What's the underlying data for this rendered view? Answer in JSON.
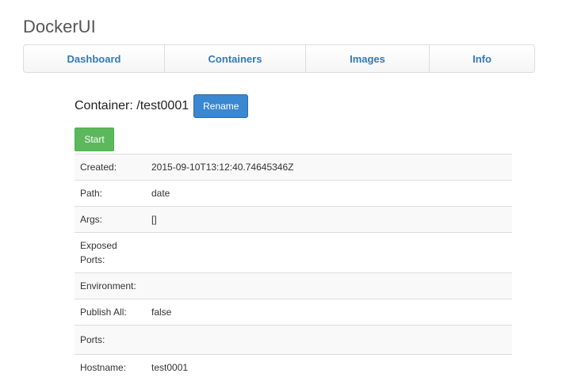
{
  "app": {
    "title": "DockerUI"
  },
  "nav": {
    "items": [
      {
        "label": "Dashboard"
      },
      {
        "label": "Containers"
      },
      {
        "label": "Images"
      },
      {
        "label": "Info"
      }
    ]
  },
  "container": {
    "title_prefix": "Container:",
    "name": "/test0001",
    "rename_label": "Rename",
    "start_label": "Start"
  },
  "details": {
    "rows": [
      {
        "label": "Created:",
        "value": "2015-09-10T13:12:40.74645346Z"
      },
      {
        "label": "Path:",
        "value": "date"
      },
      {
        "label": "Args:",
        "value": "[]"
      },
      {
        "label": "Exposed Ports:",
        "value": ""
      },
      {
        "label": "Environment:",
        "value": ""
      },
      {
        "label": "Publish All:",
        "value": "false"
      },
      {
        "label": "Ports:",
        "value": ""
      },
      {
        "label": "Hostname:",
        "value": "test0001"
      }
    ]
  },
  "colors": {
    "primary": "#3a87d2",
    "success": "#5cb85c",
    "link": "#337ab7"
  }
}
